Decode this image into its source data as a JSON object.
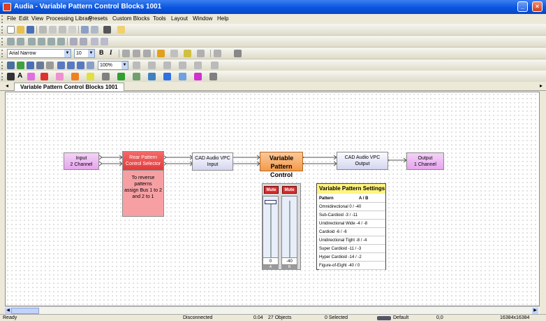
{
  "app": {
    "title": "Audia - Variable Pattern Control Blocks 1001"
  },
  "menu": [
    "File",
    "Edit",
    "View",
    "Processing Library",
    "Presets",
    "Custom Blocks",
    "Tools",
    "Layout",
    "Window",
    "Help"
  ],
  "toolbar": {
    "font": "Arial Narrow",
    "font_size": "10",
    "zoom": "100%",
    "bold": "B",
    "italic": "I"
  },
  "tab": {
    "label": "Variable Pattern Control Blocks 1001"
  },
  "blocks": {
    "input": {
      "line1": "Input",
      "line2": "2 Channel"
    },
    "rear": {
      "line1": "Rear Pattern",
      "line2": "Control Selector",
      "note_l1": "To reverse patterns",
      "note_l2": "assign Bus 1 to 2",
      "note_l3": "and 2 to 1"
    },
    "cad_in": {
      "line1": "CAD Audio VPC",
      "line2": "Input"
    },
    "vpc": {
      "line1": "Variable",
      "line2": "Pattern Control"
    },
    "cad_out": {
      "line1": "CAD Audio VPC",
      "line2": "Output"
    },
    "output": {
      "line1": "Output",
      "line2": "1 Channel"
    }
  },
  "faders": [
    {
      "mute": "Mute",
      "value": "0",
      "label": "A",
      "level": 1.0
    },
    {
      "mute": "Mute",
      "value": "-40",
      "label": "B",
      "level": 0.0
    }
  ],
  "vps": {
    "title": "Variable Pattern Settings",
    "col_pattern": "Pattern",
    "col_ab": "A / B",
    "rows": [
      "Omnidirectional 0 / -40",
      "Sub-Cardioid -3 / -11",
      "Unidirectional Wide -4 / -8",
      "Cardioid -6 / -6",
      "Unidirectional Tight -8 / -4",
      "Super Cardioid -11 / -3",
      "Hyper Cardioid -14 / -2",
      "Figure-of-Eight -40 / 0"
    ]
  },
  "status": {
    "ready": "Ready",
    "connection": "Disconnected",
    "value": "0.04",
    "objects": "27 Objects",
    "selected": "0 Selected",
    "preset": "Default",
    "coords": "0,0",
    "size": "16384x16384"
  }
}
